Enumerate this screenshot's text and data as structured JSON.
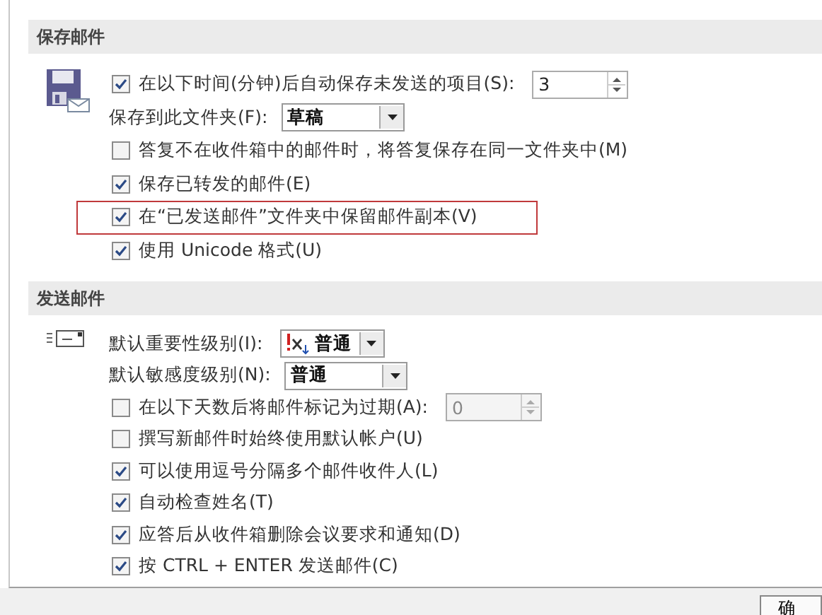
{
  "sections": [
    {
      "title": "保存邮件",
      "rows": [
        {
          "kind": "checkbox-spin",
          "label": "在以下时间(分钟)后自动保存未发送的项目(S):",
          "checked": true,
          "value": "3",
          "disabled": false,
          "highlighted": false
        },
        {
          "kind": "dropdown",
          "label": "保存到此文件夹(F):",
          "value": "草稿",
          "flag": false,
          "highlighted": false
        },
        {
          "kind": "checkbox",
          "label": "答复不在收件箱中的邮件时，将答复保存在同一文件夹中(M)",
          "checked": false,
          "highlighted": false
        },
        {
          "kind": "checkbox",
          "label": "保存已转发的邮件(E)",
          "checked": true,
          "highlighted": false
        },
        {
          "kind": "checkbox",
          "label": "在“已发送邮件”文件夹中保留邮件副本(V)",
          "checked": true,
          "highlighted": true
        },
        {
          "kind": "checkbox",
          "label": "使用 Unicode 格式(U)",
          "checked": true,
          "highlighted": false
        }
      ]
    },
    {
      "title": "发送邮件",
      "rows": [
        {
          "kind": "dropdown",
          "label": "默认重要性级别(I):",
          "value": "普通",
          "flag": true,
          "highlighted": false
        },
        {
          "kind": "dropdown",
          "label": "默认敏感度级别(N):",
          "value": "普通",
          "flag": false,
          "highlighted": false
        },
        {
          "kind": "checkbox-spin",
          "label": "在以下天数后将邮件标记为过期(A):",
          "checked": false,
          "value": "0",
          "disabled": true,
          "highlighted": false
        },
        {
          "kind": "checkbox",
          "label": "撰写新邮件时始终使用默认帐户(U)",
          "checked": false,
          "highlighted": false
        },
        {
          "kind": "checkbox",
          "label": "可以使用逗号分隔多个邮件收件人(L)",
          "checked": true,
          "highlighted": false
        },
        {
          "kind": "checkbox",
          "label": "自动检查姓名(T)",
          "checked": true,
          "highlighted": false
        },
        {
          "kind": "checkbox",
          "label": "应答后从收件箱删除会议要求和通知(D)",
          "checked": true,
          "highlighted": false
        },
        {
          "kind": "checkbox",
          "label": "按 CTRL + ENTER 发送邮件(C)",
          "checked": true,
          "highlighted": false
        }
      ]
    }
  ],
  "footer": {
    "button": "确"
  }
}
